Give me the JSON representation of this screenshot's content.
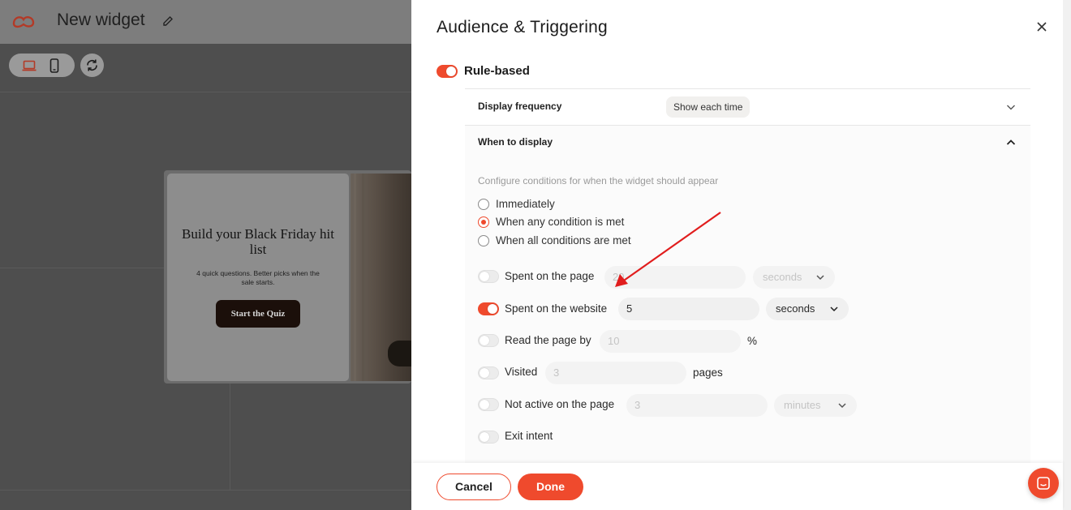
{
  "editor": {
    "widget_title": "New widget",
    "preview": {
      "heading": "Build your Black Friday hit list",
      "subtext": "4 quick questions. Better picks when the sale starts.",
      "cta": "Start the Quiz"
    }
  },
  "panel": {
    "title": "Audience & Triggering",
    "rule_based": {
      "label": "Rule-based",
      "enabled": true
    },
    "display_frequency": {
      "label": "Display frequency",
      "value": "Show each time"
    },
    "when_to_display": {
      "label": "When to display",
      "description": "Configure conditions for when the widget should appear",
      "options": [
        {
          "label": "Immediately",
          "selected": false
        },
        {
          "label": "When any condition is met",
          "selected": true
        },
        {
          "label": "When all conditions are met",
          "selected": false
        }
      ],
      "conditions": [
        {
          "label": "Spent on the page",
          "enabled": false,
          "value": "20",
          "unit": "seconds"
        },
        {
          "label": "Spent on the website",
          "enabled": true,
          "value": "5",
          "unit": "seconds"
        },
        {
          "label": "Read the page by",
          "enabled": false,
          "value": "10",
          "suffix": "%"
        },
        {
          "label": "Visited",
          "enabled": false,
          "value": "3",
          "suffix": "pages"
        },
        {
          "label": "Not active on the page",
          "enabled": false,
          "value": "3",
          "unit": "minutes"
        },
        {
          "label": "Exit intent",
          "enabled": false
        }
      ]
    },
    "footer": {
      "cancel_label": "Cancel",
      "done_label": "Done"
    }
  },
  "colors": {
    "accent": "#ef4a2d",
    "overlay": "#4d4d4d",
    "panel": "#ffffff"
  },
  "icons": [
    "logo-icon",
    "edit-icon",
    "laptop-icon",
    "phone-icon",
    "refresh-icon",
    "close-icon",
    "chevron-down-icon",
    "chevron-up-icon",
    "chat-icon",
    "annotation-arrow"
  ]
}
